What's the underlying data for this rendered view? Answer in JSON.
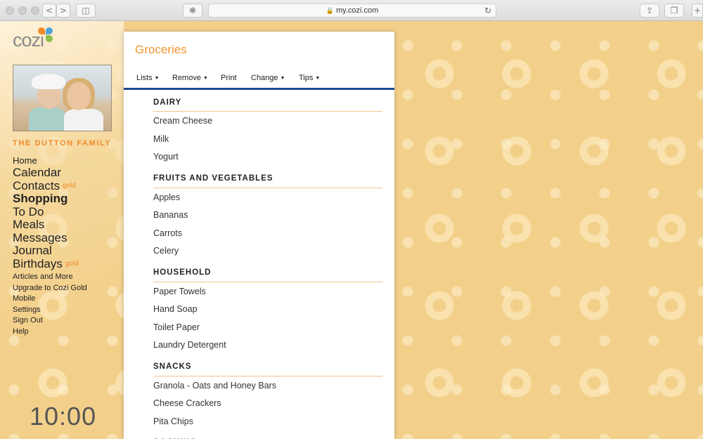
{
  "browser": {
    "url": "my.cozi.com",
    "back_icon": "<",
    "forward_icon": ">"
  },
  "sidebar": {
    "logo": "cozi",
    "family_name": "THE DUTTON FAMILY",
    "nav_main": [
      {
        "label": "Home",
        "badge": ""
      },
      {
        "label": "Calendar",
        "badge": ""
      },
      {
        "label": "Contacts",
        "badge": "gold"
      },
      {
        "label": "Shopping",
        "badge": "",
        "active": true
      },
      {
        "label": "To Do",
        "badge": ""
      },
      {
        "label": "Meals",
        "badge": ""
      },
      {
        "label": "Messages",
        "badge": ""
      },
      {
        "label": "Journal",
        "badge": ""
      },
      {
        "label": "Birthdays",
        "badge": "gold"
      }
    ],
    "nav_secondary": [
      "Articles and More",
      "Upgrade to Cozi Gold",
      "Mobile",
      "Settings",
      "Sign Out",
      "Help"
    ],
    "clock": "10:00"
  },
  "main": {
    "title": "Groceries",
    "toolbar": [
      {
        "label": "Lists",
        "dropdown": true
      },
      {
        "label": "Remove",
        "dropdown": true
      },
      {
        "label": "Print",
        "dropdown": false
      },
      {
        "label": "Change",
        "dropdown": true
      },
      {
        "label": "Tips",
        "dropdown": true
      }
    ],
    "categories": [
      {
        "name": "DAIRY",
        "items": [
          "Cream Cheese",
          "Milk",
          "Yogurt"
        ]
      },
      {
        "name": "FRUITS AND VEGETABLES",
        "items": [
          "Apples",
          "Bananas",
          "Carrots",
          "Celery"
        ]
      },
      {
        "name": "HOUSEHOLD",
        "items": [
          "Paper Towels",
          "Hand Soap",
          "Toilet Paper",
          "Laundry Detergent"
        ]
      },
      {
        "name": "SNACKS",
        "items": [
          "Granola - Oats and Honey Bars",
          "Cheese Crackers",
          "Pita Chips"
        ]
      },
      {
        "name": "COOKING",
        "items": []
      }
    ]
  },
  "colors": {
    "accent_orange": "#f0952e",
    "toolbar_rule": "#1e4b8f",
    "background": "#f3d08a"
  }
}
